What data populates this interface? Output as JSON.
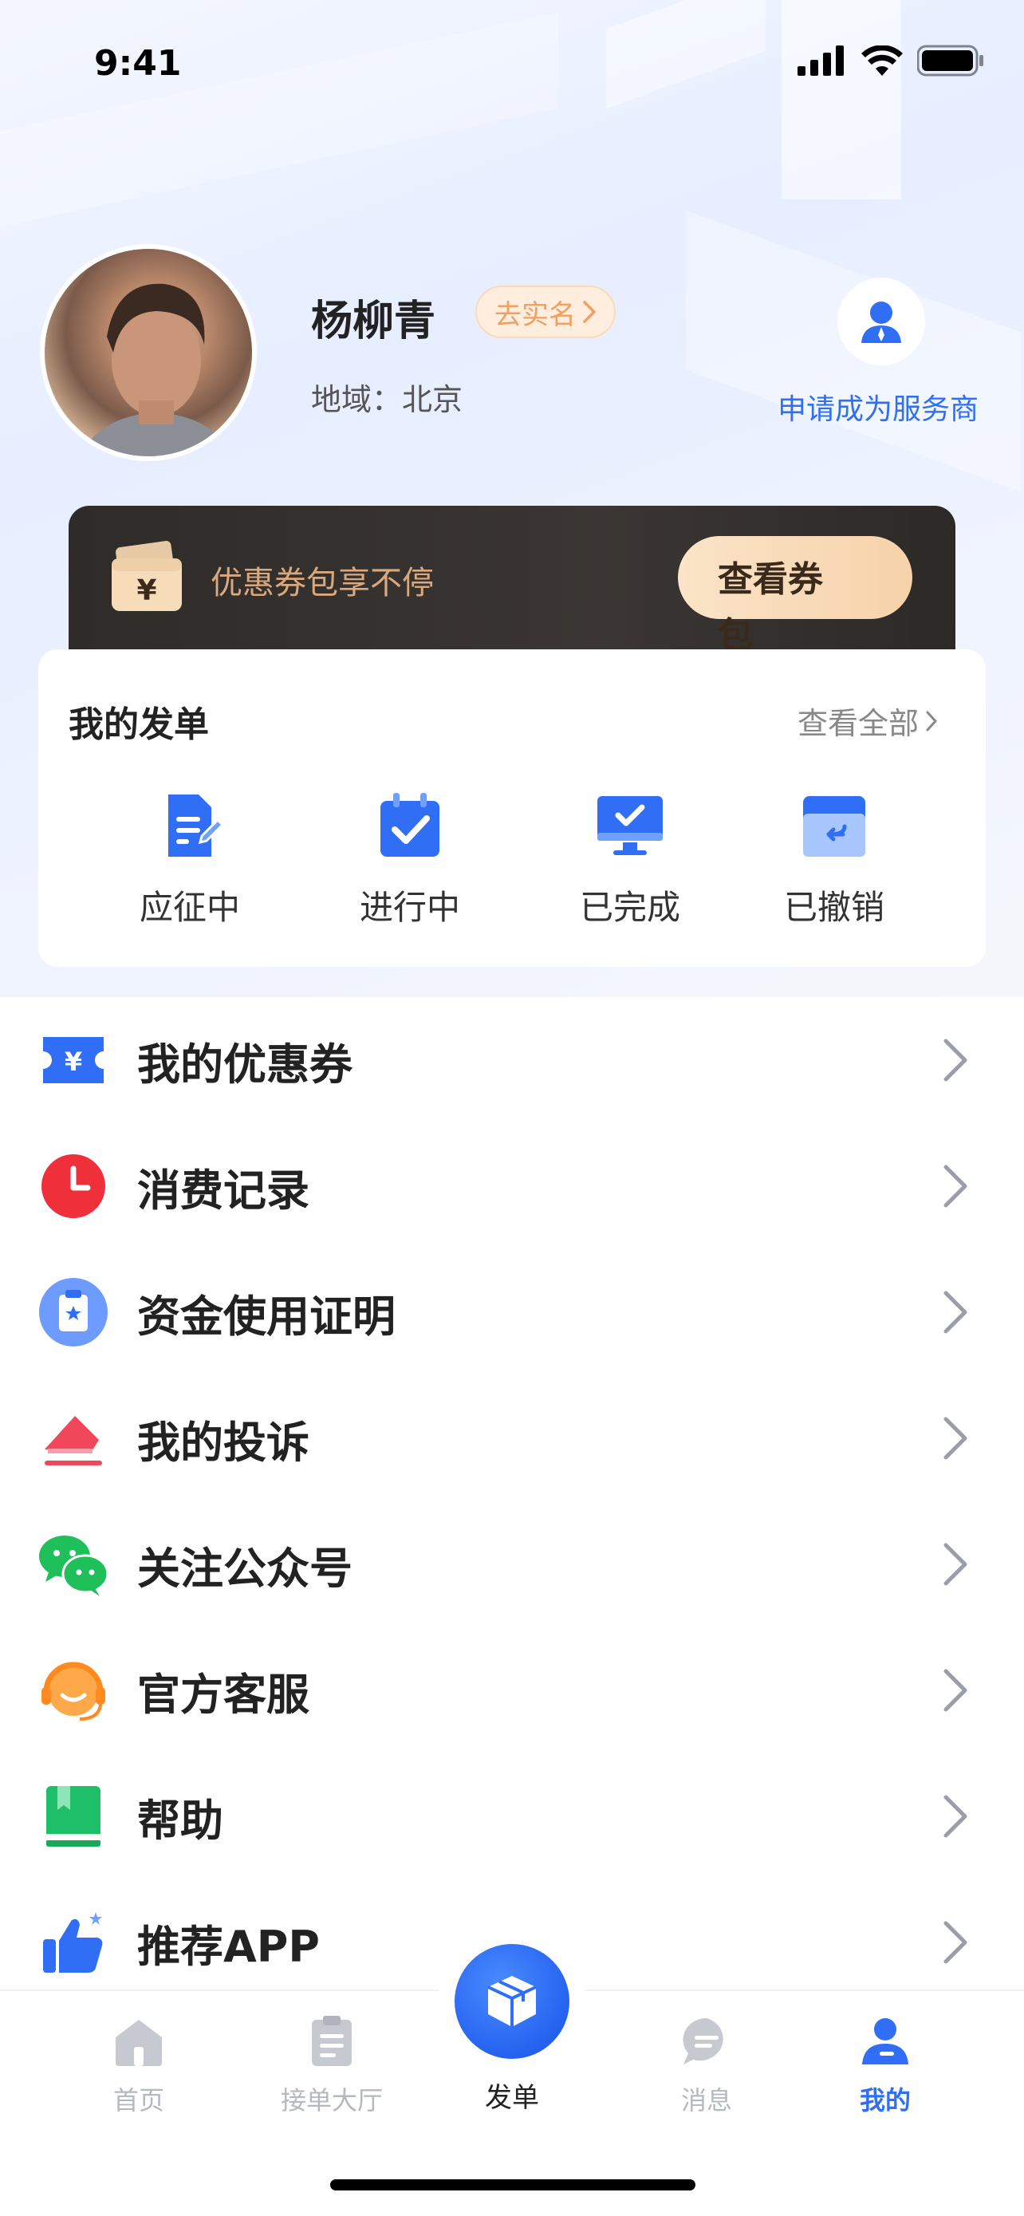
{
  "status_bar": {
    "time": "9:41"
  },
  "profile": {
    "name": "杨柳青",
    "verify_label": "去实名",
    "region": "地域：北京",
    "provider_label": "申请成为服务商"
  },
  "coupon_banner": {
    "text": "优惠券包享不停",
    "button_label": "查看券包"
  },
  "my_orders": {
    "title": "我的发单",
    "view_all": "查看全部",
    "items": [
      {
        "label": "应征中",
        "icon": "document-edit-icon"
      },
      {
        "label": "进行中",
        "icon": "calendar-check-icon"
      },
      {
        "label": "已完成",
        "icon": "monitor-check-icon"
      },
      {
        "label": "已撤销",
        "icon": "revoke-box-icon"
      }
    ]
  },
  "menu": [
    {
      "label": "我的优惠券",
      "icon": "coupon-icon"
    },
    {
      "label": "消费记录",
      "icon": "clock-icon"
    },
    {
      "label": "资金使用证明",
      "icon": "certificate-icon"
    },
    {
      "label": "我的投诉",
      "icon": "complaint-icon"
    },
    {
      "label": "关注公众号",
      "icon": "wechat-icon"
    },
    {
      "label": "官方客服",
      "icon": "customer-service-icon"
    },
    {
      "label": "帮助",
      "icon": "book-icon"
    },
    {
      "label": "推荐APP",
      "icon": "thumbs-up-icon"
    }
  ],
  "tabbar": {
    "tabs": [
      {
        "label": "首页",
        "icon": "home-icon"
      },
      {
        "label": "接单大厅",
        "icon": "clipboard-icon"
      },
      {
        "label": "发单",
        "icon": "package-icon"
      },
      {
        "label": "消息",
        "icon": "chat-icon"
      },
      {
        "label": "我的",
        "icon": "user-icon"
      }
    ],
    "active": "我的"
  },
  "colors": {
    "accent": "#2f6ef5",
    "coupon_gold": "#d9a87e",
    "banner_dark": "#2e2b29"
  }
}
